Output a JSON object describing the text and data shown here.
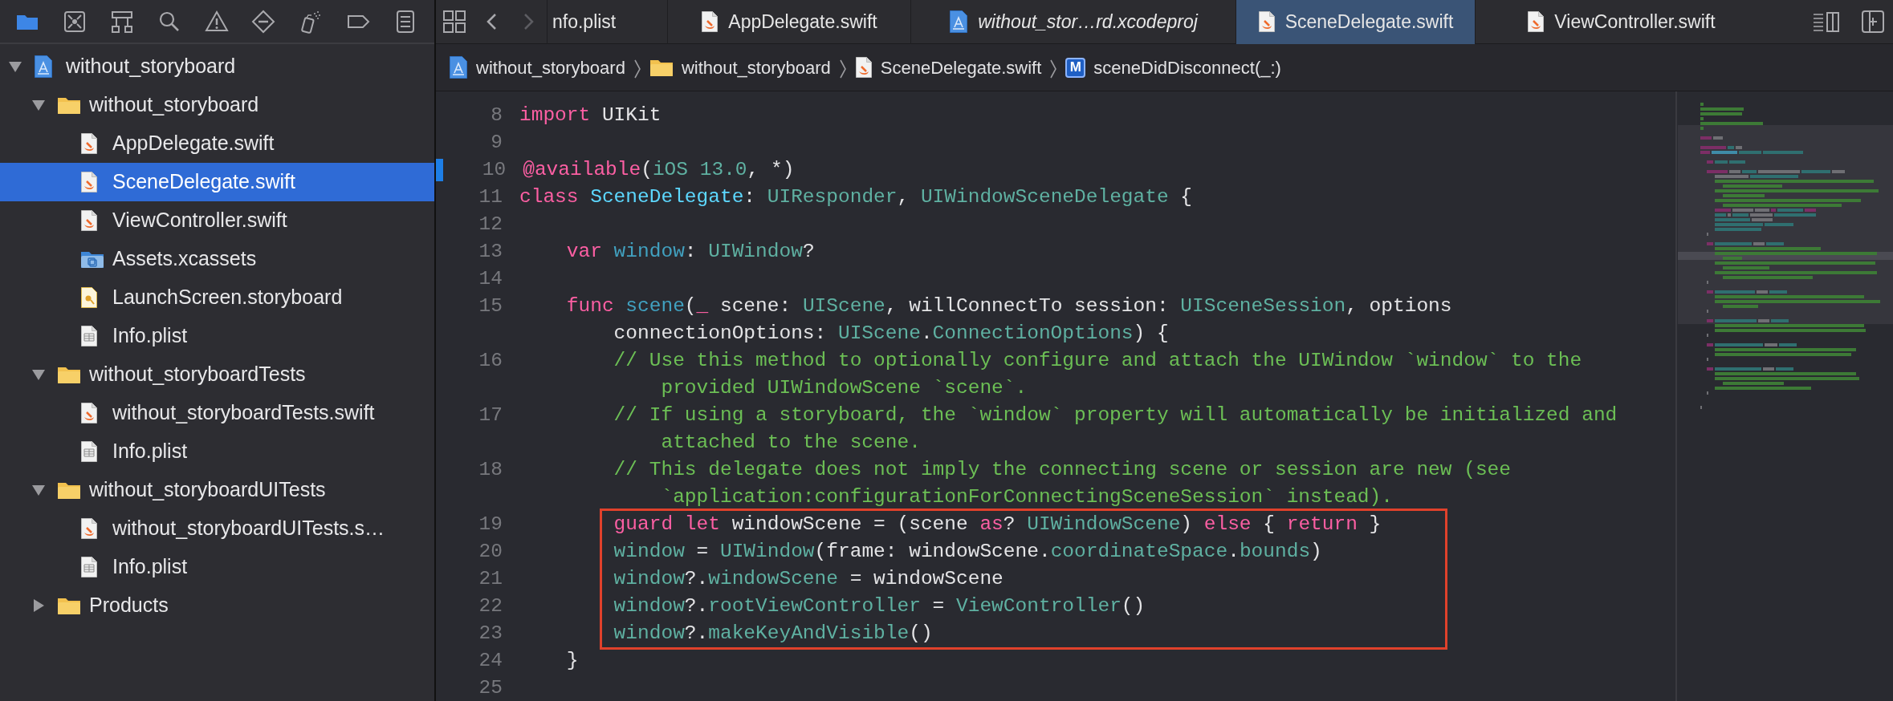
{
  "navigator_tabs": [
    {
      "kind": "files",
      "selected": true
    },
    {
      "kind": "source-control",
      "selected": false
    },
    {
      "kind": "hierarchy",
      "selected": false
    },
    {
      "kind": "search",
      "selected": false
    },
    {
      "kind": "issues",
      "selected": false
    },
    {
      "kind": "tests",
      "selected": false
    },
    {
      "kind": "debug",
      "selected": false
    },
    {
      "kind": "breakpoints",
      "selected": false
    },
    {
      "kind": "reports",
      "selected": false
    }
  ],
  "tree": [
    {
      "label": "without_storyboard",
      "kind": "project",
      "expanded": true,
      "selected": false,
      "children": [
        {
          "label": "without_storyboard",
          "kind": "folder",
          "expanded": true,
          "selected": false,
          "children": [
            {
              "label": "AppDelegate.swift",
              "kind": "swift",
              "selected": false
            },
            {
              "label": "SceneDelegate.swift",
              "kind": "swift",
              "selected": true
            },
            {
              "label": "ViewController.swift",
              "kind": "swift",
              "selected": false
            },
            {
              "label": "Assets.xcassets",
              "kind": "assets",
              "selected": false
            },
            {
              "label": "LaunchScreen.storyboard",
              "kind": "storyboard",
              "selected": false
            },
            {
              "label": "Info.plist",
              "kind": "plist",
              "selected": false
            }
          ]
        },
        {
          "label": "without_storyboardTests",
          "kind": "folder",
          "expanded": true,
          "selected": false,
          "children": [
            {
              "label": "without_storyboardTests.swift",
              "kind": "swift",
              "selected": false
            },
            {
              "label": "Info.plist",
              "kind": "plist",
              "selected": false
            }
          ]
        },
        {
          "label": "without_storyboardUITests",
          "kind": "folder",
          "expanded": true,
          "selected": false,
          "children": [
            {
              "label": "without_storyboardUITests.s…",
              "kind": "swift",
              "selected": false
            },
            {
              "label": "Info.plist",
              "kind": "plist",
              "selected": false
            }
          ]
        },
        {
          "label": "Products",
          "kind": "folder",
          "expanded": false,
          "selected": false
        }
      ]
    }
  ],
  "nav_buttons": [
    {
      "kind": "back",
      "disabled": false
    },
    {
      "kind": "forward",
      "disabled": true
    }
  ],
  "tabs": [
    {
      "label": "nfo.plist",
      "kind": "clipped",
      "selected": false,
      "preview": false
    },
    {
      "label": "AppDelegate.swift",
      "kind": "swift",
      "selected": false,
      "preview": false
    },
    {
      "label": "without_stor…rd.xcodeproj",
      "kind": "project",
      "selected": false,
      "preview": true
    },
    {
      "label": "SceneDelegate.swift",
      "kind": "swift",
      "selected": true,
      "preview": false
    },
    {
      "label": "ViewController.swift",
      "kind": "swift",
      "selected": false,
      "preview": false
    }
  ],
  "jump_bar": [
    {
      "label": "without_storyboard",
      "kind": "project"
    },
    {
      "label": "without_storyboard",
      "kind": "folder"
    },
    {
      "label": "SceneDelegate.swift",
      "kind": "swift"
    },
    {
      "label": "sceneDidDisconnect(_:)",
      "kind": "method",
      "badge": "M"
    }
  ],
  "code": [
    {
      "kind": "line",
      "number": "8",
      "tokens": [
        {
          "kind": "keyword",
          "text": "import"
        },
        {
          "kind": "plain",
          "text": " UIKit"
        }
      ]
    },
    {
      "kind": "line",
      "number": "9"
    },
    {
      "kind": "marked",
      "number": "10",
      "tokens": [
        {
          "kind": "keyword",
          "text": "@available"
        },
        {
          "kind": "plain",
          "text": "("
        },
        {
          "kind": "type",
          "text": "iOS"
        },
        {
          "kind": "type",
          "text": " 13.0"
        },
        {
          "kind": "plain",
          "text": ", *)"
        }
      ]
    },
    {
      "kind": "line",
      "number": "11",
      "tokens": [
        {
          "kind": "keyword",
          "text": "class"
        },
        {
          "kind": "decl",
          "text": " SceneDelegate"
        },
        {
          "kind": "plain",
          "text": ": "
        },
        {
          "kind": "type",
          "text": "UIResponder"
        },
        {
          "kind": "plain",
          "text": ", "
        },
        {
          "kind": "type",
          "text": "UIWindowSceneDelegate"
        },
        {
          "kind": "plain",
          "text": " {"
        }
      ]
    },
    {
      "kind": "line",
      "number": "12"
    },
    {
      "kind": "line",
      "number": "13",
      "tokens": [
        {
          "kind": "keyword",
          "text": "    var"
        },
        {
          "kind": "member",
          "text": " window"
        },
        {
          "kind": "plain",
          "text": ": "
        },
        {
          "kind": "type",
          "text": "UIWindow"
        },
        {
          "kind": "plain",
          "text": "?"
        }
      ]
    },
    {
      "kind": "line",
      "number": "14"
    },
    {
      "kind": "line",
      "number": "15",
      "tokens": [
        {
          "kind": "keyword",
          "text": "    func"
        },
        {
          "kind": "member",
          "text": " scene"
        },
        {
          "kind": "plain",
          "text": "("
        },
        {
          "kind": "keyword",
          "text": "_"
        },
        {
          "kind": "plain",
          "text": " scene: "
        },
        {
          "kind": "type",
          "text": "UIScene"
        },
        {
          "kind": "plain",
          "text": ", willConnectTo session: "
        },
        {
          "kind": "type",
          "text": "UISceneSession"
        },
        {
          "kind": "plain",
          "text": ", options"
        }
      ]
    },
    {
      "kind": "line",
      "tokens": [
        {
          "kind": "plain",
          "text": "        connectionOptions: "
        },
        {
          "kind": "type",
          "text": "UIScene"
        },
        {
          "kind": "plain",
          "text": "."
        },
        {
          "kind": "type",
          "text": "ConnectionOptions"
        },
        {
          "kind": "plain",
          "text": ") {"
        }
      ]
    },
    {
      "kind": "line",
      "number": "16",
      "tokens": [
        {
          "kind": "comment",
          "text": "        // Use this method to optionally configure and attach the UIWindow `window` to the"
        }
      ]
    },
    {
      "kind": "line",
      "tokens": [
        {
          "kind": "comment",
          "text": "            provided UIWindowScene `scene`."
        }
      ]
    },
    {
      "kind": "line",
      "number": "17",
      "tokens": [
        {
          "kind": "comment",
          "text": "        // If using a storyboard, the `window` property will automatically be initialized and"
        }
      ]
    },
    {
      "kind": "line",
      "tokens": [
        {
          "kind": "comment",
          "text": "            attached to the scene."
        }
      ]
    },
    {
      "kind": "line",
      "number": "18",
      "tokens": [
        {
          "kind": "comment",
          "text": "        // This delegate does not imply the connecting scene or session are new (see"
        }
      ]
    },
    {
      "kind": "line",
      "tokens": [
        {
          "kind": "comment",
          "text": "            `application:configurationForConnectingSceneSession` instead)."
        }
      ]
    },
    {
      "kind": "box",
      "color": "#e0412b",
      "rows": [
        {
          "kind": "line",
          "number": "19",
          "tokens": [
            {
              "kind": "keyword",
              "text": "        guard"
            },
            {
              "kind": "keyword",
              "text": " let"
            },
            {
              "kind": "plain",
              "text": " windowScene = (scene "
            },
            {
              "kind": "keyword",
              "text": "as"
            },
            {
              "kind": "plain",
              "text": "? "
            },
            {
              "kind": "type",
              "text": "UIWindowScene"
            },
            {
              "kind": "plain",
              "text": ") "
            },
            {
              "kind": "keyword",
              "text": "else"
            },
            {
              "kind": "plain",
              "text": " { "
            },
            {
              "kind": "keyword",
              "text": "return"
            },
            {
              "kind": "plain",
              "text": " }"
            }
          ]
        },
        {
          "kind": "line",
          "number": "20",
          "tokens": [
            {
              "kind": "type",
              "text": "        window"
            },
            {
              "kind": "plain",
              "text": " = "
            },
            {
              "kind": "type",
              "text": "UIWindow"
            },
            {
              "kind": "plain",
              "text": "(frame: windowScene."
            },
            {
              "kind": "type",
              "text": "coordinateSpace"
            },
            {
              "kind": "plain",
              "text": "."
            },
            {
              "kind": "type",
              "text": "bounds"
            },
            {
              "kind": "plain",
              "text": ")"
            }
          ]
        },
        {
          "kind": "line",
          "number": "21",
          "tokens": [
            {
              "kind": "type",
              "text": "        window"
            },
            {
              "kind": "plain",
              "text": "?."
            },
            {
              "kind": "type",
              "text": "windowScene"
            },
            {
              "kind": "plain",
              "text": " = windowScene"
            }
          ]
        },
        {
          "kind": "line",
          "number": "22",
          "tokens": [
            {
              "kind": "type",
              "text": "        window"
            },
            {
              "kind": "plain",
              "text": "?."
            },
            {
              "kind": "type",
              "text": "rootViewController"
            },
            {
              "kind": "plain",
              "text": " = "
            },
            {
              "kind": "type",
              "text": "ViewController"
            },
            {
              "kind": "plain",
              "text": "()"
            }
          ]
        },
        {
          "kind": "line",
          "number": "23",
          "tokens": [
            {
              "kind": "type",
              "text": "        window"
            },
            {
              "kind": "plain",
              "text": "?."
            },
            {
              "kind": "type",
              "text": "makeKeyAndVisible"
            },
            {
              "kind": "plain",
              "text": "()"
            }
          ]
        }
      ]
    },
    {
      "kind": "line",
      "number": "24",
      "tokens": [
        {
          "kind": "plain",
          "text": "    }"
        }
      ]
    },
    {
      "kind": "line",
      "number": "25"
    }
  ]
}
